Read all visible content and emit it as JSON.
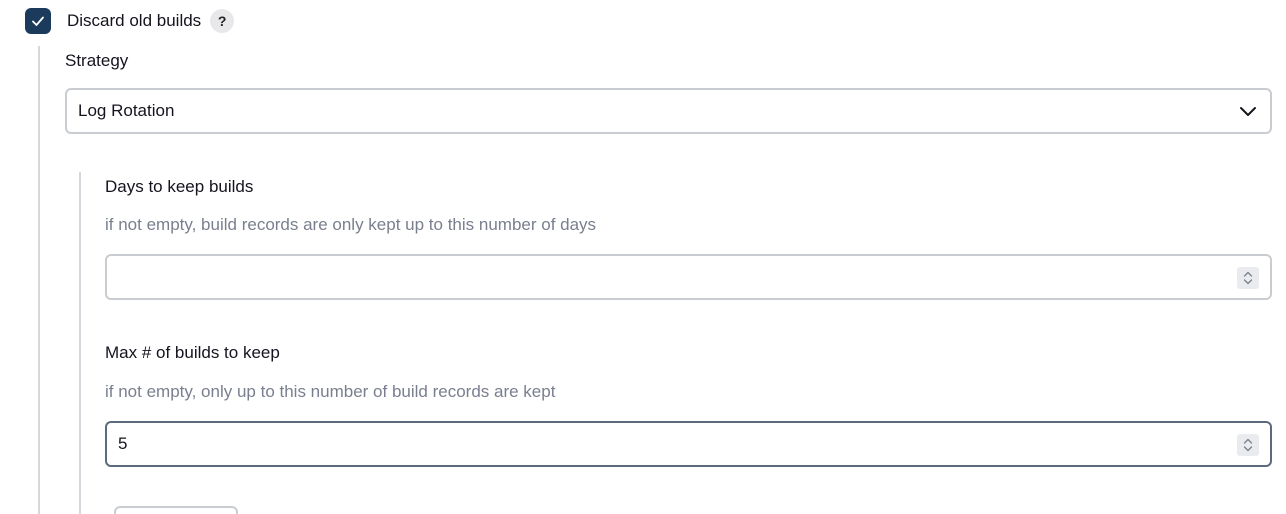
{
  "discard": {
    "checked": true,
    "label": "Discard old builds",
    "help": "?"
  },
  "strategy": {
    "label": "Strategy",
    "selected": "Log Rotation"
  },
  "days_to_keep": {
    "label": "Days to keep builds",
    "description": "if not empty, build records are only kept up to this number of days",
    "value": ""
  },
  "max_builds": {
    "label": "Max # of builds to keep",
    "description": "if not empty, only up to this number of build records are kept",
    "value": "5"
  },
  "icons": {
    "check": "check-icon",
    "dropdown": "chevron-down-icon",
    "spinner": "spinner-arrows-icon"
  },
  "colors": {
    "checkbox_bg": "#1b3a5c",
    "description_text": "#7a7f8f"
  }
}
